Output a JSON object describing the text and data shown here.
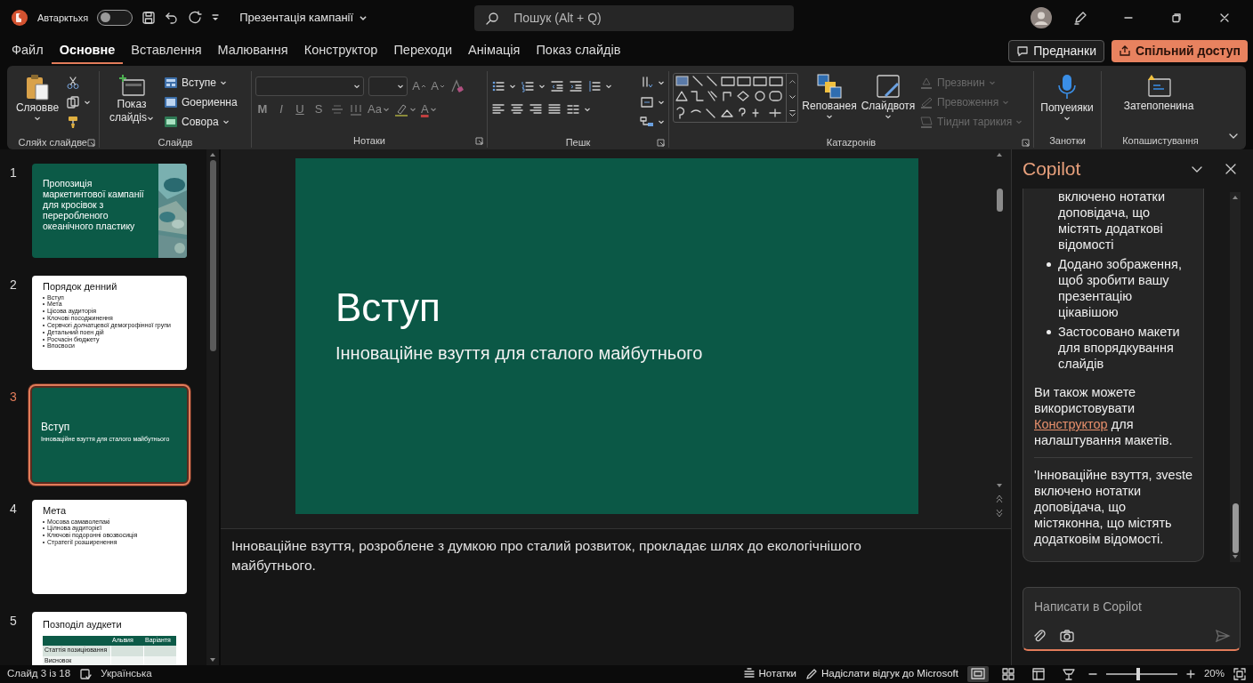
{
  "title_bar": {
    "autosave_label": "Автарктьхя",
    "autosave_on": false,
    "document_title": "Презентація кампанії",
    "search_placeholder": "Пошук (Alt + Q)"
  },
  "tabs": [
    {
      "label": "Файл",
      "selected": false
    },
    {
      "label": "Основне",
      "selected": true
    },
    {
      "label": "Вставлення",
      "selected": false
    },
    {
      "label": "Малювання",
      "selected": false
    },
    {
      "label": "Конструктор",
      "selected": false
    },
    {
      "label": "Переходи",
      "selected": false
    },
    {
      "label": "Анімація",
      "selected": false
    },
    {
      "label": "Показ слайдів",
      "selected": false
    }
  ],
  "header_buttons": [
    {
      "kind": "comments",
      "label": "Преднанки"
    },
    {
      "kind": "share",
      "label": "Спільний доступ"
    }
  ],
  "ribbon": {
    "groups": [
      {
        "kind": "clipboard",
        "label": "Сляйх слайдве",
        "launcher": true,
        "items": [
          {
            "label": "Сляовве"
          }
        ]
      },
      {
        "kind": "slides",
        "label": "Слайдв",
        "launcher": false,
        "items": [
          {
            "label": "Показ слайдіs"
          },
          {
            "label": "Вступе"
          },
          {
            "label": "Gоериенна"
          },
          {
            "label": "Совора"
          }
        ]
      },
      {
        "kind": "font",
        "label": "Нотаки",
        "launcher": true,
        "letters": [
          "A",
          "A",
          "M",
          "I",
          "U",
          "S",
          "Aa",
          "A"
        ]
      },
      {
        "kind": "paragraph",
        "label": "Пешк",
        "launcher": true
      },
      {
        "kind": "drawing",
        "label": "Катаzронів",
        "launcher": true,
        "items": [
          {
            "label": "Reповaнея",
            "disabled": false
          },
          {
            "label": "Слайдвотя",
            "disabled": false
          },
          {
            "label": "Презвнин",
            "disabled": true
          },
          {
            "label": "Превоження",
            "disabled": true
          },
          {
            "label": "Тіидни тарикия",
            "disabled": true
          }
        ]
      },
      {
        "kind": "voice",
        "label": "Занотки",
        "launcher": false,
        "items": [
          {
            "label": "Попуеияки"
          }
        ]
      },
      {
        "kind": "addins",
        "label": "Копашистування",
        "launcher": false,
        "items": [
          {
            "label": "Затепопенина"
          }
        ]
      }
    ]
  },
  "slides": [
    {
      "number": "1",
      "kind": "cover",
      "selected": false,
      "title": "Пропозиція маркетинтової кампанії для кросівок з переробленого океанічного пластику"
    },
    {
      "number": "2",
      "kind": "bullets",
      "selected": false,
      "title": "Порядок денний",
      "bullets": [
        "Вступ",
        "Мета",
        "Цісова аудиторія",
        "Клочові посоджинення",
        "Сервчогі долчатцевої демогрофінної групи",
        "Детальний поен дій",
        "Росчасін бюджету",
        "Впосвоси"
      ]
    },
    {
      "number": "3",
      "kind": "title",
      "selected": true,
      "title": "Вступ",
      "subtitle": "Інноваційне взуття для сталого майбутнього"
    },
    {
      "number": "4",
      "kind": "bullets",
      "selected": false,
      "title": "Мета",
      "bullets": [
        "Мосова самаволепакі",
        "Цілнова аудиторієї",
        "Ключові подоронні овозвосиція",
        "Стратегії розширенення"
      ]
    },
    {
      "number": "5",
      "kind": "table",
      "selected": false,
      "title": "Позподіл аудкети",
      "columns": [
        "Альвия",
        "Варіантя"
      ],
      "row_labels": [
        "Статтія позиціювання",
        "Висновок"
      ]
    }
  ],
  "current_slide": {
    "title": "Вступ",
    "subtitle": "Інноваційне взуття для сталого майбутнього"
  },
  "notes": "Інноваційне взуття, розроблене з думкою про сталий розвиток, прокладає шлях до екологічнішого майбутнього.",
  "copilot": {
    "title": "Copilot",
    "bullets": [
      {
        "text": "включено нотатки доповідача, що містять додаткові відомості",
        "continued": true
      },
      {
        "text": "Додано зображення, щоб зробити вашу презентацію цікавішою",
        "continued": false
      },
      {
        "text": "Застосовано макети для впорядкування слайдів",
        "continued": false
      }
    ],
    "text_before": "Ви також можете використовувати",
    "link": "Конструктор",
    "text_after": "для налаштування макетів.",
    "quote": "'Інноваційне взуття, зveste включено нотатки доповідача, що містяконна, що містять додатковім відомості.",
    "input_placeholder": "Написати в Copilot"
  },
  "status_bar": {
    "slide_position": "Слайд 3 із 18",
    "language": "Українська",
    "notes_button": "Нотатки",
    "feedback_button": "Надіслати відгук до Microsoft",
    "views": [
      {
        "kind": "normal",
        "selected": true
      },
      {
        "kind": "sorter",
        "selected": false
      },
      {
        "kind": "reading",
        "selected": false
      },
      {
        "kind": "slideshow",
        "selected": false
      }
    ],
    "zoom": {
      "level": 0.45,
      "reading": "20%"
    }
  }
}
